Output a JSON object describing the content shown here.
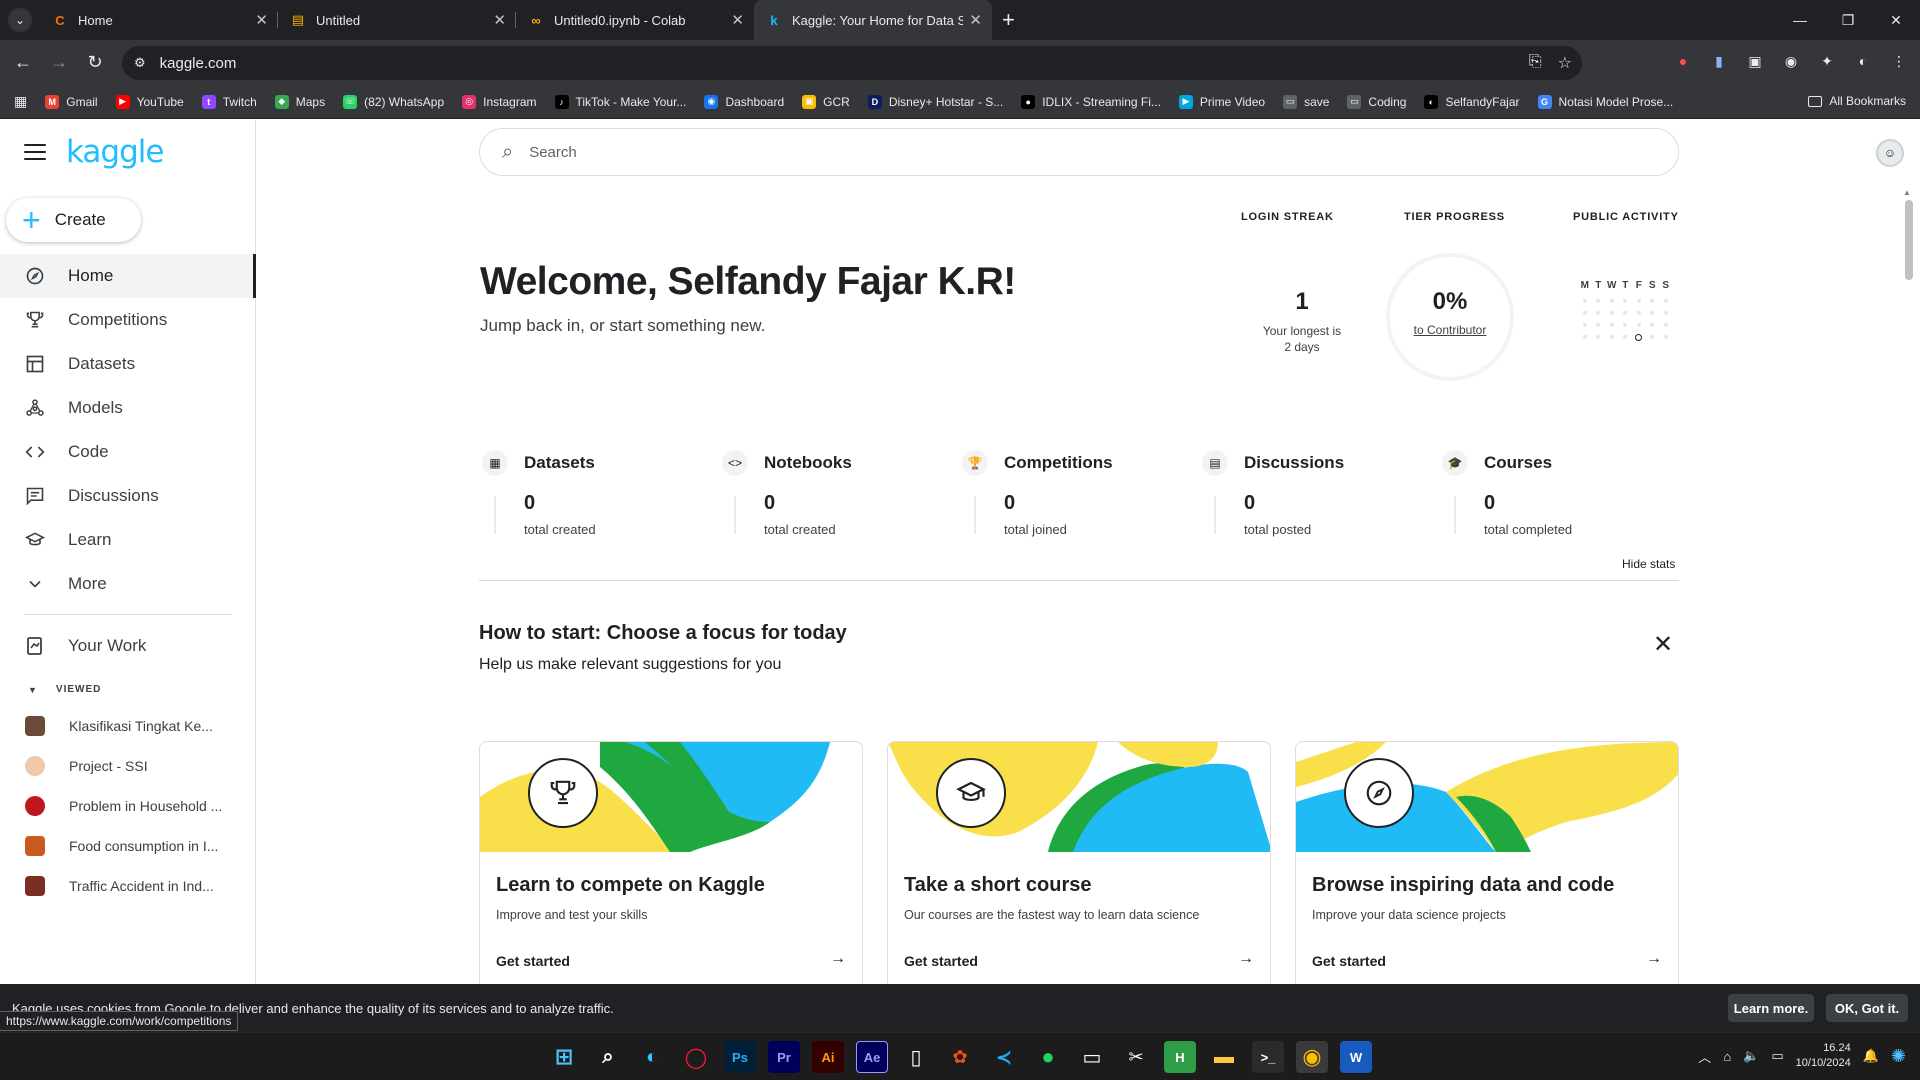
{
  "browser": {
    "tabs": [
      {
        "title": "Home",
        "icon": "C",
        "icon_color": "#ff6d00"
      },
      {
        "title": "Untitled",
        "icon": "▤",
        "icon_color": "#f9ab00"
      },
      {
        "title": "Untitled0.ipynb - Colab",
        "icon": "∞",
        "icon_color": "#f9ab00"
      },
      {
        "title": "Kaggle: Your Home for Data Sc",
        "icon": "k",
        "icon_color": "#20beff"
      }
    ],
    "url": "kaggle.com",
    "bookmarks": [
      {
        "label": "Gmail",
        "color": "#ea4335",
        "glyph": "M"
      },
      {
        "label": "YouTube",
        "color": "#ff0000",
        "glyph": "▶"
      },
      {
        "label": "Twitch",
        "color": "#9146ff",
        "glyph": "t"
      },
      {
        "label": "Maps",
        "color": "#34a853",
        "glyph": "◆"
      },
      {
        "label": "(82) WhatsApp",
        "color": "#25d366",
        "glyph": "☏"
      },
      {
        "label": "Instagram",
        "color": "#e1306c",
        "glyph": "◎"
      },
      {
        "label": "TikTok - Make Your...",
        "color": "#000000",
        "glyph": "♪"
      },
      {
        "label": "Dashboard",
        "color": "#1a73e8",
        "glyph": "◉"
      },
      {
        "label": "GCR",
        "color": "#fbbc04",
        "glyph": "▣"
      },
      {
        "label": "Disney+ Hotstar - S...",
        "color": "#0f1e5a",
        "glyph": "D"
      },
      {
        "label": "IDLIX - Streaming Fi...",
        "color": "#000000",
        "glyph": "●"
      },
      {
        "label": "Prime Video",
        "color": "#00a8e1",
        "glyph": "▶"
      },
      {
        "label": "save",
        "color": "#5f6368",
        "glyph": "▭"
      },
      {
        "label": "Coding",
        "color": "#5f6368",
        "glyph": "▭"
      },
      {
        "label": "SelfandyFajar",
        "color": "#000000",
        "glyph": "◐"
      },
      {
        "label": "Notasi Model Prose...",
        "color": "#4285f4",
        "glyph": "G"
      }
    ],
    "all_bookmarks": "All Bookmarks",
    "status_url": "https://www.kaggle.com/work/competitions"
  },
  "sidebar": {
    "logo": "kaggle",
    "create_label": "Create",
    "nav": [
      {
        "label": "Home",
        "icon": "compass"
      },
      {
        "label": "Competitions",
        "icon": "trophy"
      },
      {
        "label": "Datasets",
        "icon": "table"
      },
      {
        "label": "Models",
        "icon": "models"
      },
      {
        "label": "Code",
        "icon": "code"
      },
      {
        "label": "Discussions",
        "icon": "comment"
      },
      {
        "label": "Learn",
        "icon": "school"
      },
      {
        "label": "More",
        "icon": "chevron-down"
      }
    ],
    "your_work": "Your Work",
    "viewed_label": "VIEWED",
    "viewed": [
      {
        "label": "Klasifikasi Tingkat Ke...",
        "color": "#6b4a3a"
      },
      {
        "label": "Project - SSI",
        "color": "#f0c9a8"
      },
      {
        "label": "Problem in Household ...",
        "color": "#c0161d"
      },
      {
        "label": "Food consumption in I...",
        "color": "#c85a1e"
      },
      {
        "label": "Traffic Accident in Ind...",
        "color": "#7a2f23"
      }
    ]
  },
  "main": {
    "search_placeholder": "Search",
    "welcome": "Welcome, Selfandy Fajar K.R!",
    "welcome_sub": "Jump back in, or start something new.",
    "login_streak": {
      "label": "LOGIN STREAK",
      "value": "1",
      "sub_1": "Your longest is",
      "sub_2": "2 days"
    },
    "tier_progress": {
      "label": "TIER PROGRESS",
      "value": "0%",
      "sub": "to Contributor"
    },
    "public_activity": {
      "label": "PUBLIC ACTIVITY",
      "days": [
        "M",
        "T",
        "W",
        "T",
        "F",
        "S",
        "S"
      ]
    },
    "stats": [
      {
        "label": "Datasets",
        "value": "0",
        "sub": "total created",
        "icon": "▦"
      },
      {
        "label": "Notebooks",
        "value": "0",
        "sub": "total created",
        "icon": "<>"
      },
      {
        "label": "Competitions",
        "value": "0",
        "sub": "total joined",
        "icon": "🏆"
      },
      {
        "label": "Discussions",
        "value": "0",
        "sub": "total posted",
        "icon": "▤"
      },
      {
        "label": "Courses",
        "value": "0",
        "sub": "total completed",
        "icon": "🎓"
      }
    ],
    "hide_stats": "Hide stats",
    "focus_title": "How to start: Choose a focus for today",
    "focus_sub": "Help us make relevant suggestions for you",
    "cards": [
      {
        "title": "Learn to compete on Kaggle",
        "desc": "Improve and test your skills",
        "link": "Get started",
        "icon": "trophy"
      },
      {
        "title": "Take a short course",
        "desc": "Our courses are the fastest way to learn data science",
        "link": "Get started",
        "icon": "school"
      },
      {
        "title": "Browse inspiring data and code",
        "desc": "Improve your data science projects",
        "link": "Get started",
        "icon": "compass"
      }
    ]
  },
  "cookie": {
    "text": "Kaggle uses cookies from Google to deliver and enhance the quality of its services and to analyze traffic.",
    "learn_more": "Learn more.",
    "ok": "OK, Got it."
  },
  "taskbar": {
    "time": "16.24",
    "date": "10/10/2024"
  },
  "colors": {
    "kaggle_blue": "#20beff",
    "yellow": "#f9e04b",
    "green": "#1fa840",
    "sky": "#20bbf5"
  }
}
